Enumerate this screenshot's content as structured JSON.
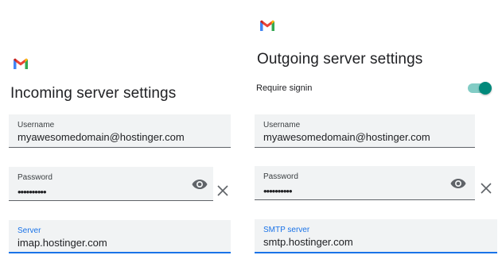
{
  "app_logo": "gmail-logo",
  "incoming": {
    "title": "Incoming server settings",
    "username": {
      "label": "Username",
      "value": "myawesomedomain@hostinger.com"
    },
    "password": {
      "label": "Password",
      "value": "••••••••••"
    },
    "server": {
      "label": "Server",
      "value": "imap.hostinger.com"
    }
  },
  "outgoing": {
    "title": "Outgoing server settings",
    "require_signin": {
      "label": "Require signin",
      "enabled": true
    },
    "username": {
      "label": "Username",
      "value": "myawesomedomain@hostinger.com"
    },
    "password": {
      "label": "Password",
      "value": "••••••••••"
    },
    "server": {
      "label": "SMTP server",
      "value": "smtp.hostinger.com"
    }
  },
  "icons": {
    "eye": "eye-icon",
    "clear": "close-icon"
  },
  "colors": {
    "focus": "#1a73e8",
    "toggle": "#00897b",
    "field_bg": "#f1f3f4"
  }
}
